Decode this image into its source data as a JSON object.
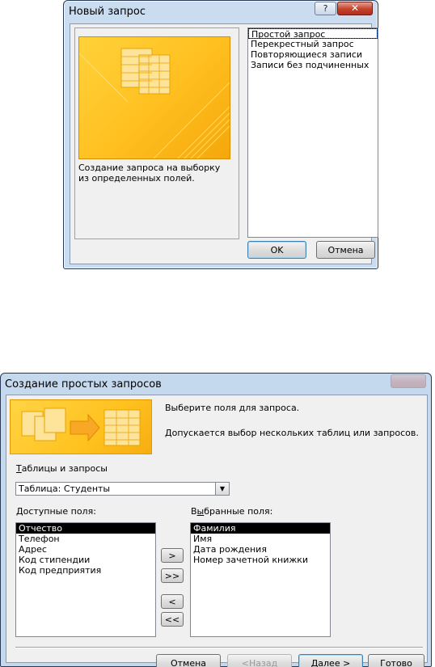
{
  "dialog1": {
    "title": "Новый запрос",
    "help_label": "?",
    "close_label": "✕",
    "description": "Создание запроса на выборку из определенных полей.",
    "query_types": [
      "Простой запрос",
      "Перекрестный запрос",
      "Повторяющиеся записи",
      "Записи без подчиненных"
    ],
    "selected_index": 0,
    "ok_label": "OK",
    "cancel_label": "Отмена"
  },
  "dialog2": {
    "title": "Создание простых запросов",
    "intro_line1": "Выберите поля для запроса.",
    "intro_line2": "Допускается выбор нескольких таблиц или запросов.",
    "tables_label": {
      "mnemonic": "Т",
      "rest": "аблицы и запросы"
    },
    "tables_value": "Таблица: Студенты",
    "available_label": {
      "mnemonic": "Д",
      "rest": "оступные поля:"
    },
    "selected_label": {
      "pre": "В",
      "mnemonic": "ы",
      "rest": "бранные поля:"
    },
    "available_fields": [
      "Отчество",
      "Телефон",
      "Адрес",
      "Код стипендии",
      "Код предприятия"
    ],
    "selected_fields": [
      "Фамилия",
      "Имя",
      "Дата рождения",
      "Номер зачетной книжки"
    ],
    "move_buttons": {
      "add_one": ">",
      "add_all": ">>",
      "remove_one": "<",
      "remove_all": "<<"
    },
    "buttons": {
      "cancel": "Отмена",
      "back": {
        "pre": "< ",
        "mnemonic": "Н",
        "rest": "азад"
      },
      "next": {
        "mnemonic": "Д",
        "rest": "алее >"
      },
      "finish": {
        "mnemonic": "Г",
        "rest": "отово"
      }
    }
  },
  "colors": {
    "accent_yellow": "#ffc21f",
    "selection": "#000000",
    "window_frame": "#c9dcf0",
    "close_red": "#c4412a"
  }
}
